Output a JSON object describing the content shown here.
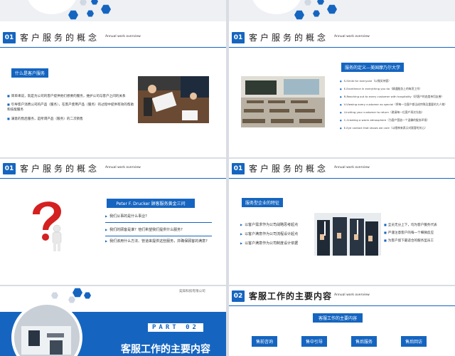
{
  "common": {
    "subtitle_en": "Annual work overview"
  },
  "slide1": {
    "num": "01",
    "title": "客户服务的概念",
    "tag": "什么是客户服务",
    "bullets": [
      "简单来说，就是为公司的客户提供他们想要的服务，维护公司与客户之间的关系",
      "引导客户消费公司的产品（服务），在客户使用产品（服务）的过程中提供有效的帮助和技能服务",
      "满意的售后服务，是所谓产品（服务）的二次销售"
    ]
  },
  "slide2": {
    "num": "01",
    "title": "客户服务的概念",
    "tag": "服务的定义—美国摩乃尔大学",
    "items": [
      "S-Smile for everyone（以微笑待客）",
      "E-Excellence in everything you do（精通服务上的每项工作）",
      "R-Reaching out to every customer with hospitality（好客户的态度亲切友善）",
      "V-Viewing every customer as special（将每一位客户都当成特殊及重要的大人物）",
      "I-Inviting your customer to return（邀请每一位客户再次光临）",
      "C-Creating a warm atmosphere（为客户营造一个温馨的服务环境）",
      "E-Eye contact that shows we care（以眼神来表示对顾客的关心）"
    ]
  },
  "slide3": {
    "num": "01",
    "title": "客户服务的概念",
    "tag": "Peter F. Drucker 顾客服务黄金三问",
    "questions": [
      "我们从事的是什么事业?",
      "我们的顾客是谁？他们希望我们提供什么服务?",
      "我们该用什么方法、管道来提供这些服务，并确保顾客的满意?"
    ]
  },
  "slide4": {
    "num": "01",
    "title": "客户服务的概念",
    "tag": "服务型企业的特征",
    "left": [
      "以客户需求作为公司战略思考起点",
      "以客户满意作为公司流程设计起点",
      "以客户满意作为公司制度设计依据"
    ],
    "right": [
      "全员无分上下，均为客户服务代表",
      "严谨注意客户的每一个细微反应",
      "为客户留下最适合的服务型员工"
    ]
  },
  "slide5": {
    "company": "奕知科技有限公司",
    "part_label": "PART 02",
    "title": "客服工作的主要内容"
  },
  "slide6": {
    "num": "02",
    "title": "客服工作的主要内容",
    "tag": "客服工作的主要内容",
    "buttons": [
      "售前咨询",
      "售中引导",
      "售后服务",
      "售后回访"
    ]
  }
}
